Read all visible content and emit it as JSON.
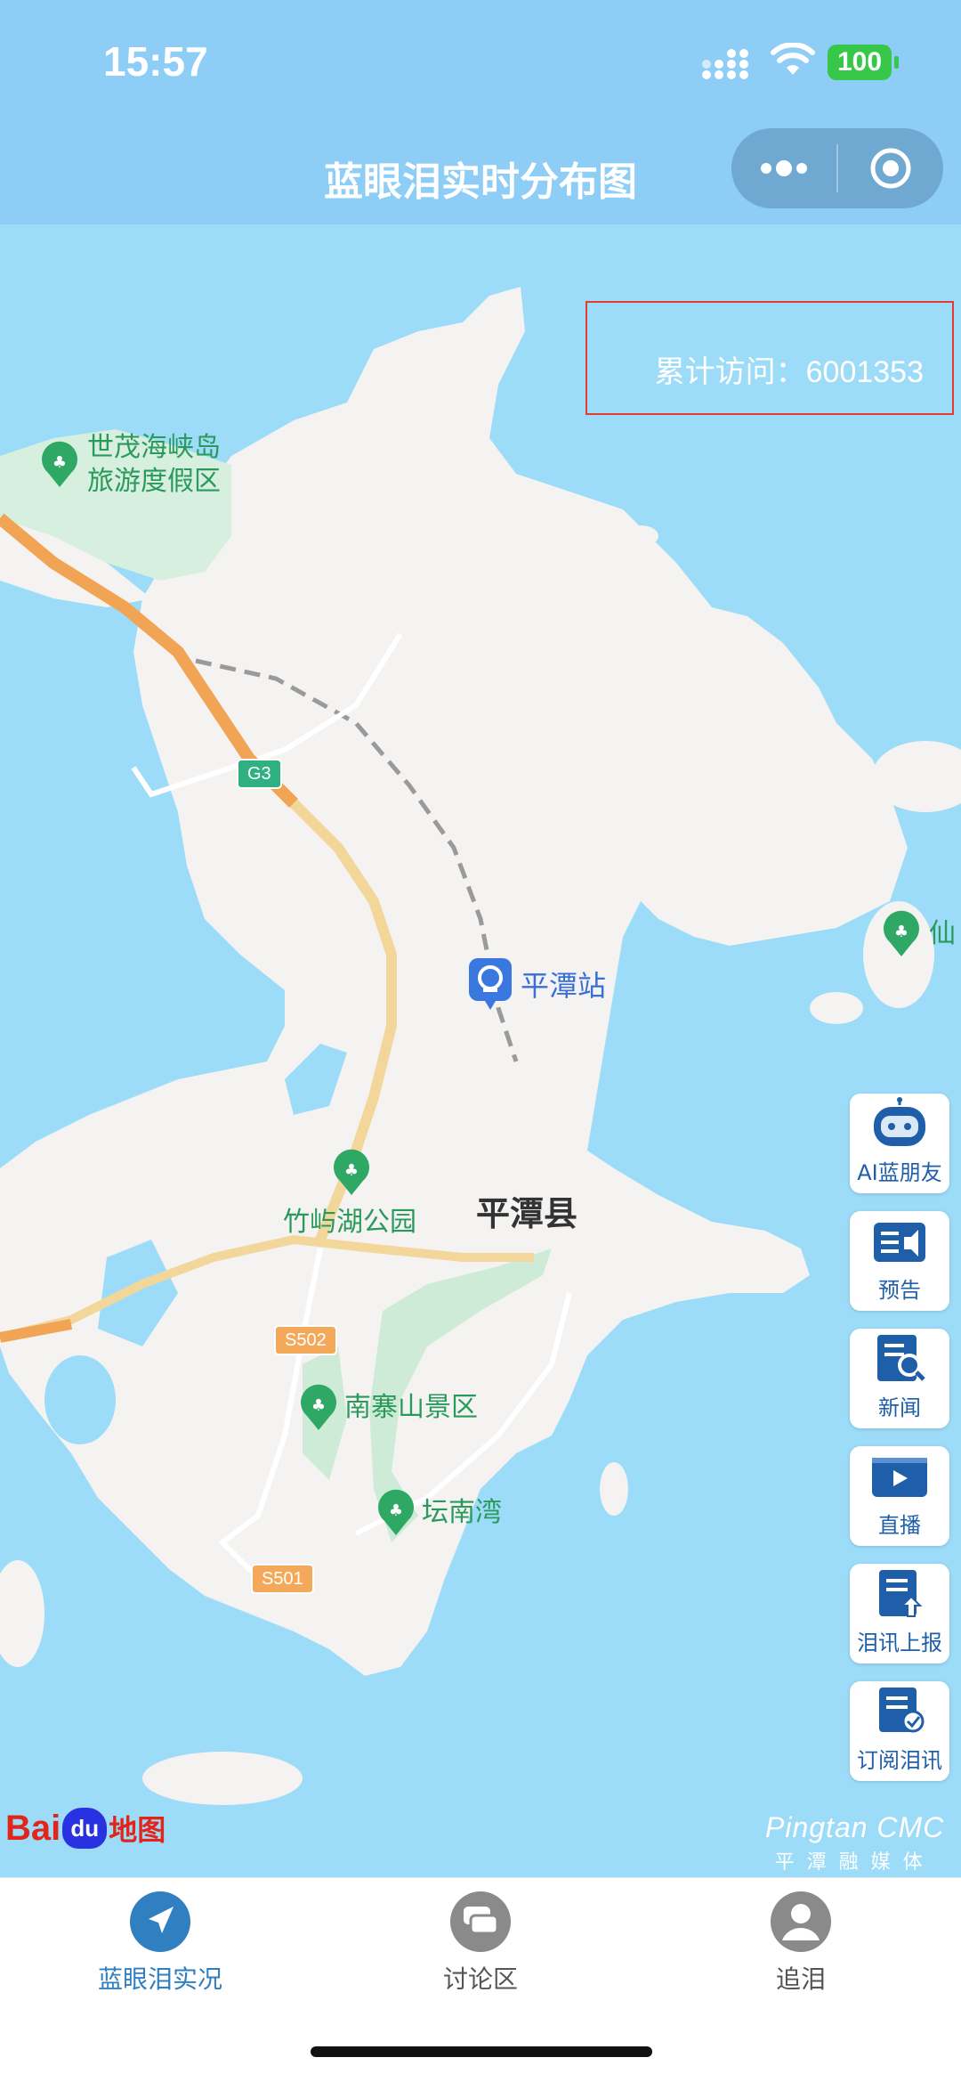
{
  "status": {
    "time": "15:57",
    "battery": "100"
  },
  "nav": {
    "title": "蓝眼泪实时分布图"
  },
  "map": {
    "visits_label": "累计访问：6001353",
    "pois": {
      "shimao": [
        "世茂海峡岛",
        "旅游度假区"
      ],
      "station": "平潭站",
      "lake_park": "竹屿湖公园",
      "county": "平潭县",
      "nanzhai": "南寨山景区",
      "tannan": "坛南湾",
      "xian": "仙"
    },
    "roads": {
      "g3": "G3",
      "s502": "S502",
      "s501": "S501"
    },
    "logo": {
      "bai": "Bai",
      "du": "du",
      "map": "地图"
    },
    "brand": {
      "en": "Pingtan CMC",
      "cn": "平潭融媒体"
    }
  },
  "side_buttons": [
    {
      "label": "AI蓝朋友",
      "icon": "robot-icon"
    },
    {
      "label": "预告",
      "icon": "announcement-icon"
    },
    {
      "label": "新闻",
      "icon": "news-icon"
    },
    {
      "label": "直播",
      "icon": "live-video-icon"
    },
    {
      "label": "泪讯上报",
      "icon": "report-upload-icon"
    },
    {
      "label": "订阅泪讯",
      "icon": "subscribe-icon"
    }
  ],
  "tabs": [
    {
      "label": "蓝眼泪实况",
      "icon": "navigation-arrow-icon",
      "active": true
    },
    {
      "label": "讨论区",
      "icon": "chat-bubbles-icon",
      "active": false
    },
    {
      "label": "追泪",
      "icon": "user-icon",
      "active": false
    }
  ],
  "colors": {
    "sea": "#9cdcf8",
    "land": "#f4f3f1",
    "accent": "#1f5ea8",
    "header": "#8ecdf6"
  }
}
